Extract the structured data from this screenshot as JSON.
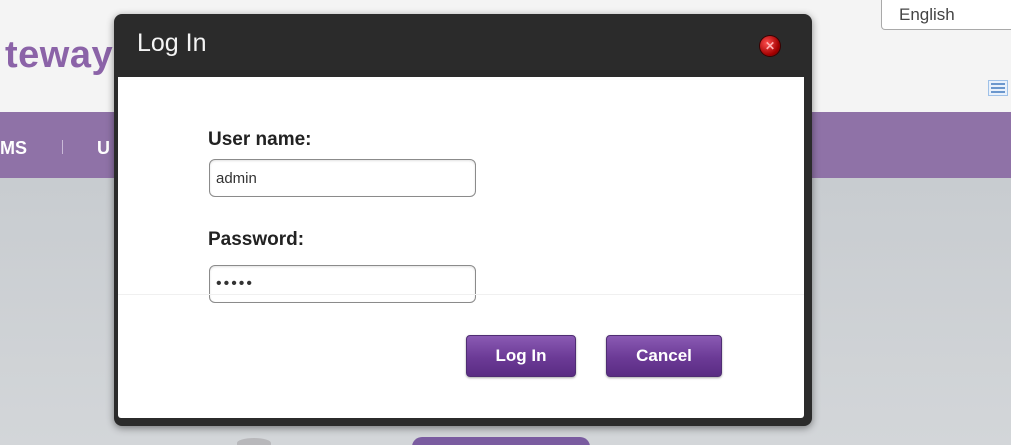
{
  "background": {
    "brand_text": "teway",
    "language": "English",
    "nav": {
      "item_1": "MS",
      "item_2": "U"
    }
  },
  "dialog": {
    "title": "Log In",
    "username_label": "User name:",
    "username_value": "admin",
    "password_label": "Password:",
    "password_value": "•••••",
    "login_button": "Log In",
    "cancel_button": "Cancel"
  },
  "colors": {
    "brand_purple": "#8b63a8",
    "nav_purple": "#8f72a7",
    "dialog_header": "#2b2b2b",
    "button_purple": "#6b3a96",
    "close_red": "#c40000"
  },
  "icons": {
    "close": "close-icon",
    "menu": "menu-icon"
  }
}
